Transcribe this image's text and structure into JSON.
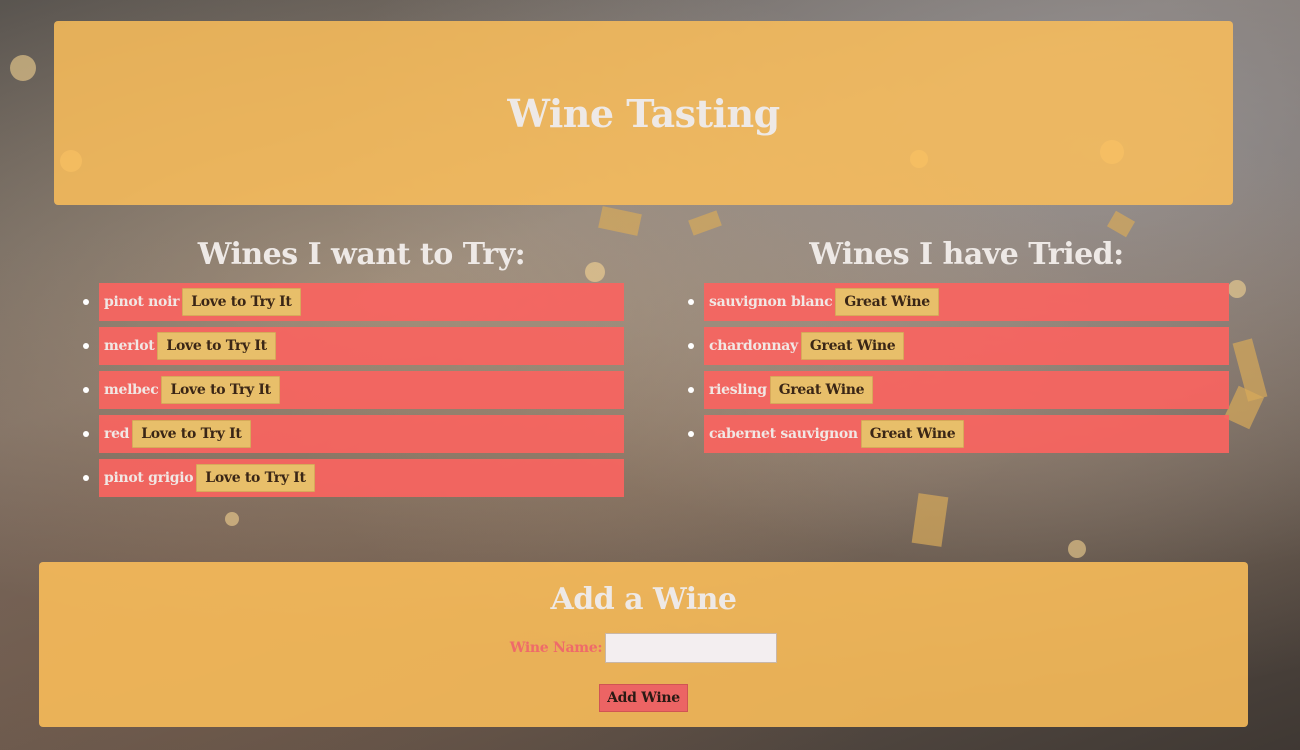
{
  "header": {
    "title": "Wine Tasting"
  },
  "want_to_try": {
    "heading": "Wines I want to Try:",
    "items": [
      {
        "name": "pinot noir",
        "button": "Love to Try It"
      },
      {
        "name": "merlot",
        "button": "Love to Try It"
      },
      {
        "name": "melbec",
        "button": "Love to Try It"
      },
      {
        "name": "red",
        "button": "Love to Try It"
      },
      {
        "name": "pinot grigio",
        "button": "Love to Try It"
      }
    ]
  },
  "have_tried": {
    "heading": "Wines I have Tried:",
    "items": [
      {
        "name": "sauvignon blanc",
        "button": "Great Wine"
      },
      {
        "name": "chardonnay",
        "button": "Great Wine"
      },
      {
        "name": "riesling",
        "button": "Great Wine"
      },
      {
        "name": "cabernet sauvignon",
        "button": "Great Wine"
      }
    ]
  },
  "add_form": {
    "heading": "Add a Wine",
    "label": "Wine Name:",
    "input_value": "",
    "placeholder": "",
    "submit": "Add Wine"
  },
  "colors": {
    "panel": "#fcbe5a",
    "list_item": "#fa645f",
    "tag_button": "#e8bf6a",
    "submit_button": "#ec6464"
  }
}
